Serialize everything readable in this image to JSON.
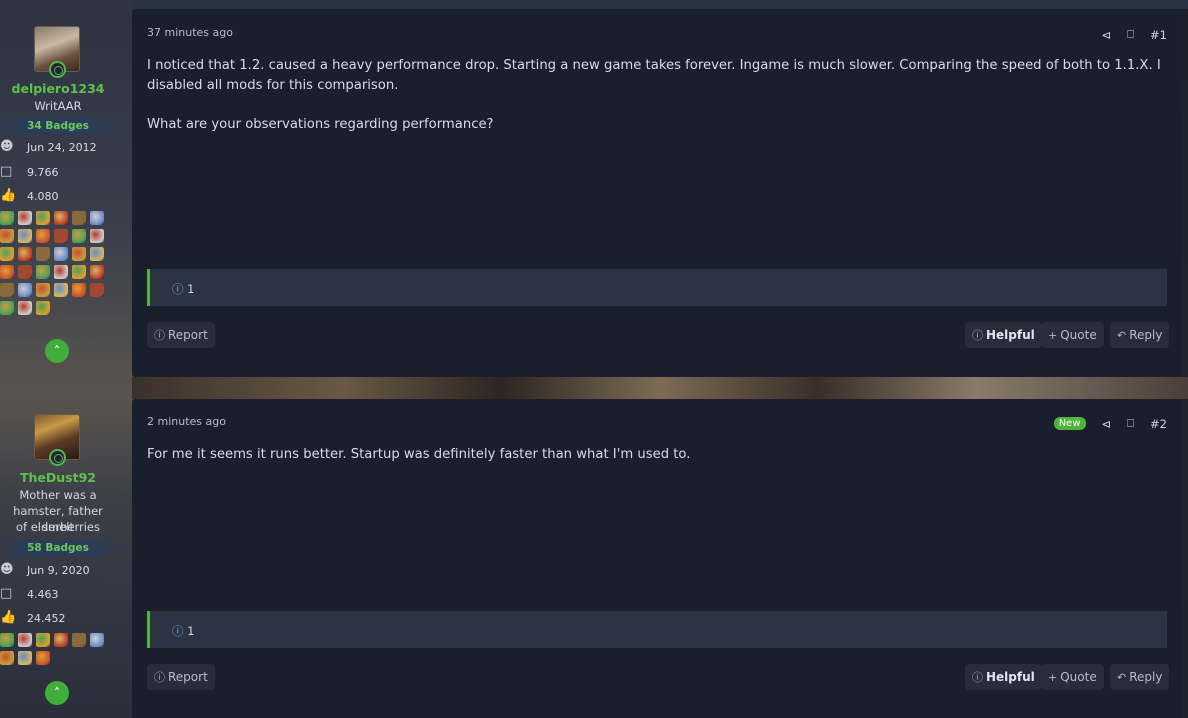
{
  "users": [
    {
      "name": "delpiero1234",
      "title": "WritAAR",
      "badges": "34 Badges",
      "joined": "Jun 24, 2012",
      "messages": "9.766",
      "reactions": "4.080"
    },
    {
      "name": "TheDust92",
      "title_lines": [
        "Mother was a",
        "hamster, father smelt",
        "of elderberries"
      ],
      "badges": "58 Badges",
      "joined": "Jun 9, 2020",
      "messages": "4.463",
      "reactions": "24.452"
    }
  ],
  "posts": [
    {
      "time": "37 minutes ago",
      "number": "#1",
      "paragraphs": [
        "I noticed that 1.2. caused a heavy performance drop. Starting a new game takes forever. Ingame is much slower. Comparing the speed of both to 1.1.X. I disabled all mods for this comparison.",
        "What are your observations regarding performance?"
      ],
      "reaction_count": "1"
    },
    {
      "time": "2 minutes ago",
      "badge": "New",
      "number": "#2",
      "paragraphs": [
        "For me it seems it runs better. Startup was definitely faster than what I'm used to."
      ],
      "reaction_count": "1"
    }
  ],
  "buttons": {
    "report": "Report",
    "helpful": "Helpful",
    "quote": "Quote",
    "reply": "Reply"
  },
  "icons": {
    "share": "share-icon",
    "bookmark": "bookmark-icon",
    "info": "info-icon",
    "up": "chevron-up-icon"
  },
  "colors": {
    "accent_green": "#4eb43a",
    "username_green": "#5fc24c",
    "post_bg": "#1a1f2e"
  }
}
